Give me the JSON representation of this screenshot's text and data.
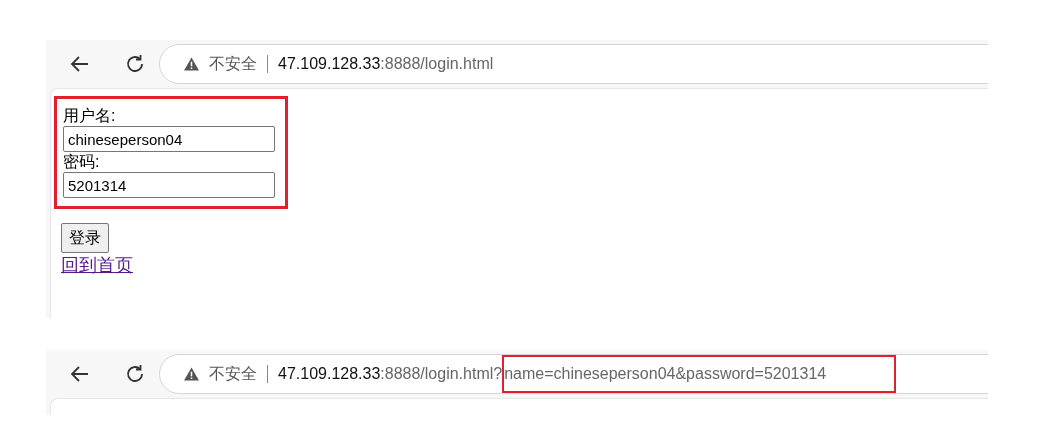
{
  "browsers": [
    {
      "address_bar": {
        "security": "不安全",
        "url_parts": [
          {
            "text": "47.109.128.33",
            "kind": "host",
            "highlighted": false
          },
          {
            "text": ":8888/login.html",
            "kind": "path",
            "highlighted": false
          }
        ]
      },
      "page": {
        "form": {
          "highlighted": true,
          "fields": [
            {
              "label": "用户名:",
              "value": "chineseperson04"
            },
            {
              "label": "密码:",
              "value": "5201314"
            }
          ]
        },
        "button": "登录",
        "link": "回到首页"
      }
    },
    {
      "address_bar": {
        "security": "不安全",
        "url_parts": [
          {
            "text": "47.109.128.33",
            "kind": "host",
            "highlighted": false
          },
          {
            "text": ":8888/login.html?",
            "kind": "path",
            "highlighted": false
          },
          {
            "text": "name=chineseperson04&password=5201314",
            "kind": "path",
            "highlighted": true
          }
        ]
      }
    }
  ]
}
